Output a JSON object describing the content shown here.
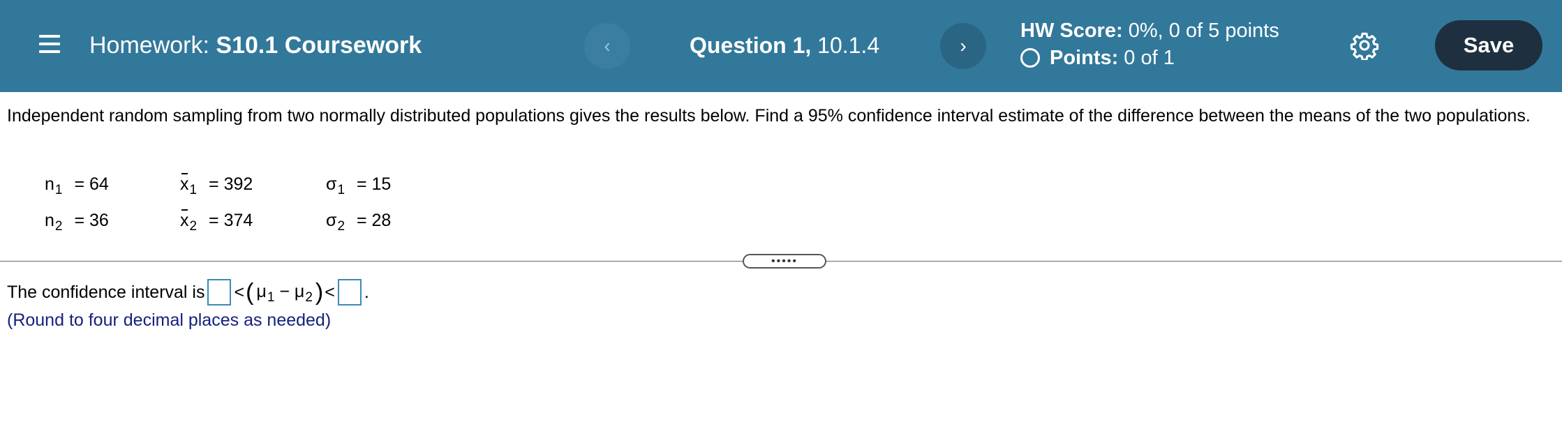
{
  "header": {
    "menu_icon": "hamburger-menu-icon",
    "homework_prefix": "Homework:",
    "homework_name": "S10.1 Coursework",
    "question_label": "Question 1,",
    "question_id": "10.1.4",
    "prev_symbol": "‹",
    "next_symbol": "›",
    "score_label": "HW Score:",
    "score_value": "0%, 0 of 5 points",
    "points_label": "Points:",
    "points_value": "0 of 1",
    "settings_icon": "gear-icon",
    "save_label": "Save",
    "colors": {
      "bar": "#32789a",
      "save": "#1e2f3f"
    }
  },
  "problem": {
    "text": "Independent random sampling from two normally distributed populations gives the results below. Find a 95% confidence interval estimate of the difference between the means of the two populations.",
    "givens": [
      {
        "n_sym": "n",
        "n_sub": "1",
        "n_val": "= 64",
        "x_sym": "x",
        "x_sub": "1",
        "x_val": "= 392",
        "s_sym": "σ",
        "s_sub": "1",
        "s_val": "= 15"
      },
      {
        "n_sym": "n",
        "n_sub": "2",
        "n_val": "= 36",
        "x_sym": "x",
        "x_sub": "2",
        "x_val": "= 374",
        "s_sym": "σ",
        "s_sub": "2",
        "s_val": "= 28"
      }
    ]
  },
  "divider": {
    "handle_text": "•••••"
  },
  "answer": {
    "prefix": "The confidence interval is",
    "lt1": "<",
    "mu1": "μ",
    "mu1_sub": "1",
    "minus": "−",
    "mu2": "μ",
    "mu2_sub": "2",
    "lt2": "<",
    "suffix": ".",
    "hint": "(Round to four decimal places as needed)",
    "lower_value": "",
    "upper_value": ""
  }
}
